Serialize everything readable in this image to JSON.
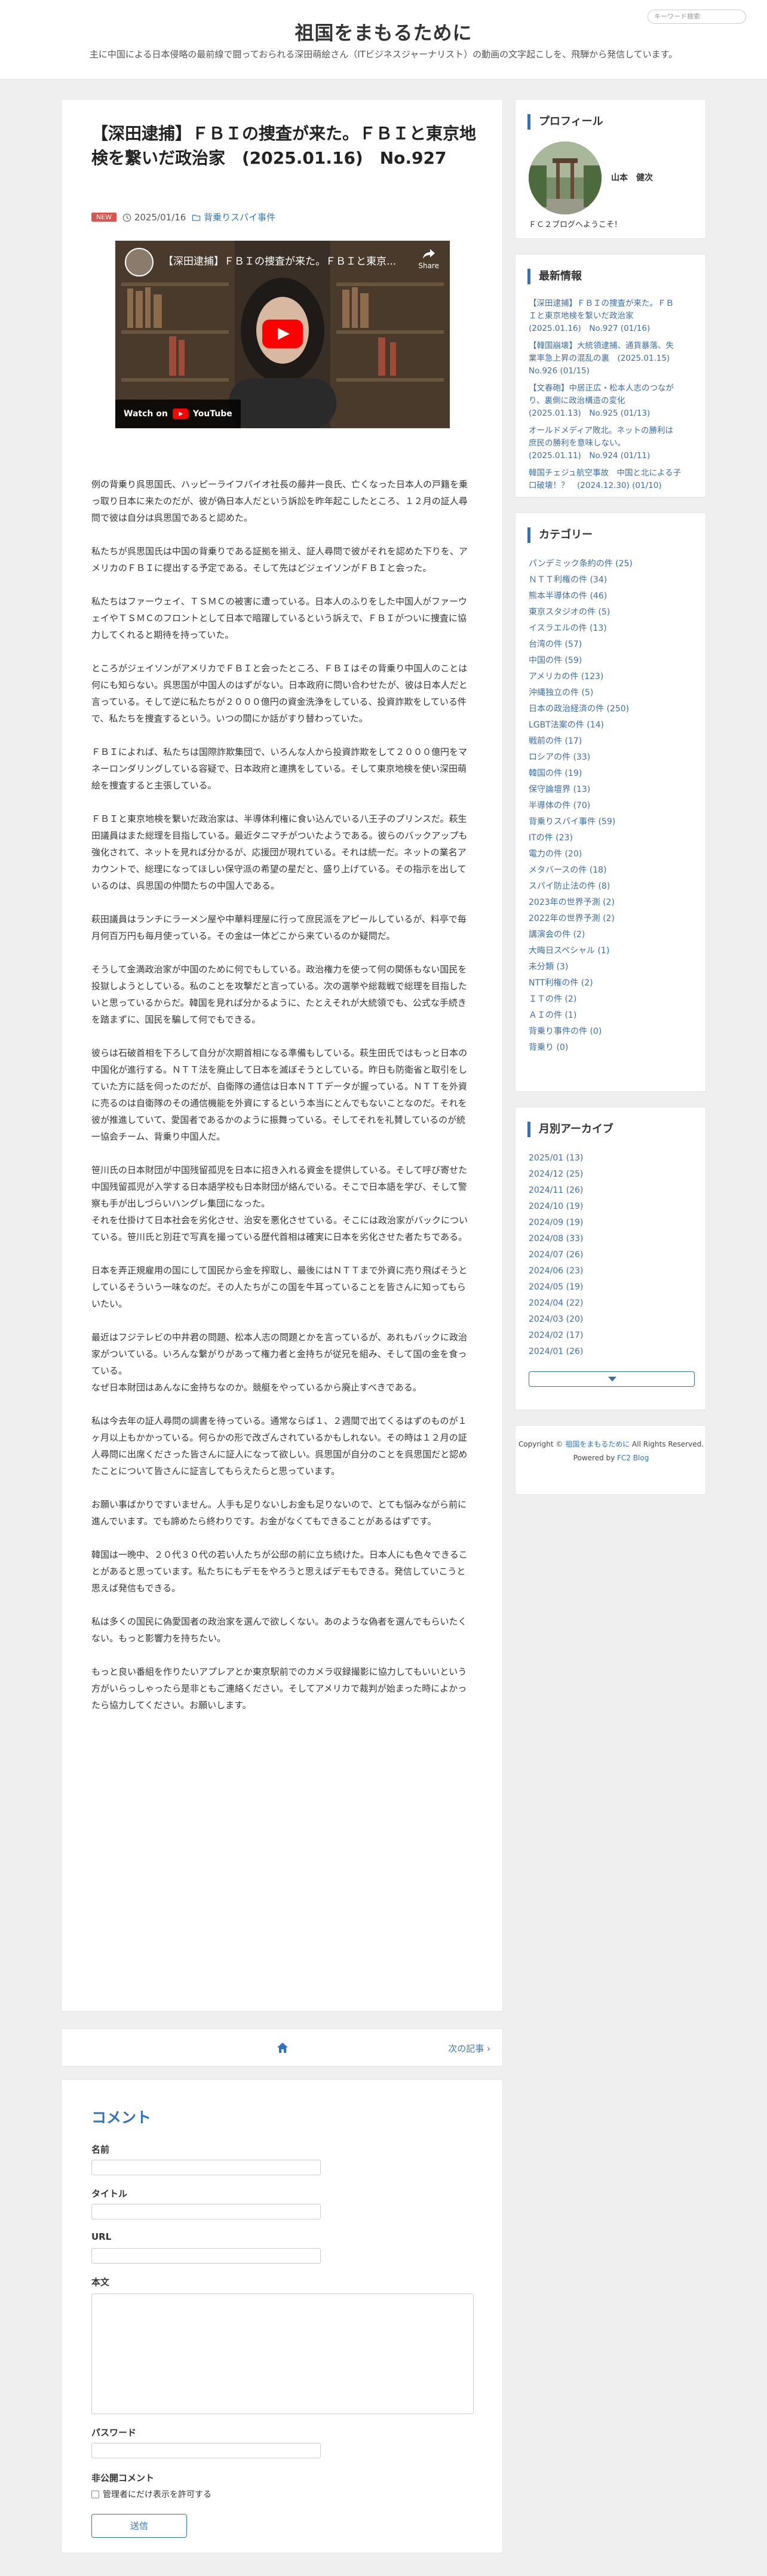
{
  "header": {
    "site_title": "祖国をまもるために",
    "site_desc": "主に中国による日本侵略の最前線で闘っておられる深田萌絵さん（ITビジネスジャーナリスト）の動画の文字起こしを、飛騨から発信しています。",
    "search_placeholder": "キーワード検索"
  },
  "article": {
    "title": "【深田逮捕】ＦＢＩの捜査が来た。ＦＢＩと東京地検を繋いだ政治家　(2025.01.16)　No.927",
    "badge": "NEW",
    "date": "2025/01/16",
    "category": "背乗りスパイ事件",
    "video": {
      "title": "【深田逮捕】ＦＢＩの捜査が来た。ＦＢＩと東京...",
      "share_label": "Share",
      "watch_label": "Watch on",
      "youtube_label": "YouTube"
    },
    "paragraphs": [
      "例の背乗り呉思国氏、ハッピーライフパイオ社長の藤井一良氏、亡くなった日本人の戸籍を乗っ取り日本に来たのだが、彼が偽日本人だという訴訟を昨年起こしたところ、１２月の証人尋問で彼は自分は呉思国であると認めた。",
      "私たちが呉思国氏は中国の背乗りである証拠を揃え、証人尋問で彼がそれを認めた下りを、アメリカのＦＢＩに提出する予定である。そして先はどジェイソンがＦＢＩと会った。",
      "私たちはファーウェイ、ＴＳＭＣの被害に遭っている。日本人のふりをした中国人がファーウェイやＴＳＭＣのフロントとして日本で暗躍しているという訴えで、ＦＢＩがついに捜査に協力してくれると期待を持っていた。",
      "ところがジェイソンがアメリカでＦＢＩと会ったところ、ＦＢＩはその背乗り中国人のことは何にも知らない。呉思国が中国人のはずがない。日本政府に問い合わせたが、彼は日本人だと言っている。そして逆に私たちが２０００億円の資金洗浄をしている、投資詐欺をしている件で、私たちを捜査するという。いつの間にか話がすり替わっていた。",
      "ＦＢＩによれば、私たちは国際詐欺集団で、いろんな人から投資詐欺をして２０００億円をマネーロンダリングしている容疑で、日本政府と連携をしている。そして東京地検を使い深田萌絵を捜査すると主張している。",
      "ＦＢＩと東京地検を繋いだ政治家は、半導体利権に食い込んでいる八王子のプリンスだ。萩生田議員はまた総理を目指している。最近タニマチがついたようである。彼らのバックアップも強化されて、ネットを見れば分かるが、応援団が現れている。それは統一だ。ネットの業名アカウントで、総理になってほしい保守派の希望の星だと、盛り上げている。その指示を出しているのは、呉思国の仲間たちの中国人である。",
      "萩田議員はランチにラーメン屋や中華料理屋に行って庶民派をアピールしているが、料亭で毎月何百万円も毎月使っている。その金は一体どこから来ているのか疑問だ。",
      "そうして金満政治家が中国のために何でもしている。政治権力を使って何の関係もない国民を投獄しようとしている。私のことを攻撃だと言っている。次の選挙や総裁戦で総理を目指したいと思っているからだ。韓国を見れば分かるように、たとえそれが大統領でも、公式な手続きを踏まずに、国民を騙して何でもできる。",
      "彼らは石破首相を下ろして自分が次期首相になる準備もしている。萩生田氏ではもっと日本の中国化が進行する。ＮＴＴ法を廃止して日本を滅ぼそうとしている。昨日も防衛省と取引をしていた方に話を伺ったのだが、自衛隊の通信は日本ＮＴＴデータが握っている。ＮＴＴを外資に売るのは自衛隊のその通信機能を外資にするという本当にとんでもないことなのだ。それを彼が推進していて、愛国者であるかのように振舞っている。そしてそれを礼賛しているのが統一協会チーム、背乗り中国人だ。",
      "笹川氏の日本財団が中国残留孤児を日本に招き入れる資金を提供している。そして呼び寄せた中国残留孤児が入学する日本語学校も日本財団が絡んでいる。そこで日本語を学び、そして警察も手が出しづらいハングレ集団になった。",
      "それを仕掛けて日本社会を劣化させ、治安を悪化させている。そこには政治家がバックについている。笹川氏と別荘で写真を撮っている歴代首相は確実に日本を劣化させた者たちである。",
      "日本を弄正規雇用の国にして国民から金を搾取し、最後にはＮＴＴまで外資に売り飛ばそうとしているそういう一味なのだ。その人たちがこの国を牛耳っていることを皆さんに知ってもらいたい。",
      "最近はフジテレビの中井君の問題、松本人志の問題とかを言っているが、あれもバックに政治家がついている。いろんな繋がりがあって権力者と金持ちが従兄を組み、そして国の金を食っている。",
      "なぜ日本財団はあんなに金持ちなのか。競艇をやっているから廃止すべきである。",
      "私は今去年の証人尋問の調書を待っている。通常ならば１、２週間で出てくるはずのものが１ヶ月以上もかかっている。何らかの形で改ざんされているかもしれない。その時は１２月の証人尋問に出席くださった皆さんに証人になって欲しい。呉思国が自分のことを呉思国だと認めたことについて皆さんに証言してもらえたらと思っています。",
      "お願い事ばかりですいません。人手も足りないしお金も足りないので、とても悩みながら前に進んでいます。でも諦めたら終わりです。お金がなくてもできることがあるはずです。",
      "韓国は一晩中、２０代３０代の若い人たちが公邸の前に立ち続けた。日本人にも色々できることがあると思っています。私たちにもデモをやろうと思えばデモもできる。発信していこうと思えば発信もできる。",
      "私は多くの国民に偽愛国者の政治家を選んで欲しくない。あのような偽者を選んでもらいたくない。もっと影響力を持ちたい。",
      "もっと良い番組を作りたいアプレアとか東京駅前でのカメラ収録撮影に協力してもいいという方がいらっしゃったら是非ともご連絡ください。そしてアメリカで裁判が始まった時によかったら協力してください。お願いします。"
    ]
  },
  "pager": {
    "next_label": "次の記事"
  },
  "comment": {
    "heading": "コメント",
    "name_label": "名前",
    "title_label": "タイトル",
    "url_label": "URL",
    "body_label": "本文",
    "password_label": "パスワード",
    "private_label": "非公開コメント",
    "private_check": "管理者にだけ表示を許可する",
    "submit_label": "送信"
  },
  "sidebar": {
    "profile": {
      "title": "プロフィール",
      "name": "山本　健次",
      "text": "ＦＣ２ブログへようこそ！"
    },
    "latest": {
      "title": "最新情報",
      "items": [
        [
          "【深田逮捕】ＦＢＩの捜査が来た。ＦＢ",
          "Ｉと東京地検を繋いだ政治家",
          "(2025.01.16)　No.927 (01/16)"
        ],
        [
          "【韓国崩壊】大統領逮捕、通貨暴落、失",
          "業率急上昇の混乱の裏　(2025.01.15)",
          "No.926 (01/15)"
        ],
        [
          "【文春砲】中居正広・松本人志のつなが",
          "り、裏側に政治構造の変化",
          "(2025.01.13)　No.925 (01/13)"
        ],
        [
          "オールドメディア敗北。ネットの勝利は",
          "庶民の勝利を意味しない。",
          "(2025.01.11)　No.924 (01/11)"
        ],
        [
          "韓国チェジュ航空事故　中国と北による子",
          "口破壊！？　(2024.12.30) (01/10)"
        ]
      ]
    },
    "categories": {
      "title": "カテゴリー",
      "items": [
        "パンデミック条約の件 (25)",
        "ＮＴＴ利権の件 (34)",
        "熊本半導体の件 (46)",
        "東京スタジオの件 (5)",
        "イスラエルの件 (13)",
        "台湾の件 (57)",
        "中国の件 (59)",
        "アメリカの件 (123)",
        "沖縄独立の件 (5)",
        "日本の政治経済の件 (250)",
        "LGBT法案の件 (14)",
        "戦前の件 (17)",
        "ロシアの件 (33)",
        "韓国の件 (19)",
        "保守論壇界 (13)",
        "半導体の件 (70)",
        "背乗りスパイ事件 (59)",
        "ITの件 (23)",
        "電力の件 (20)",
        "メタバースの件 (18)",
        "スパイ防止法の件 (8)",
        "2023年の世界予測 (2)",
        "2022年の世界予測 (2)",
        "講演会の件 (2)",
        "大晦日スペシャル (1)",
        "未分類 (3)",
        "NTT利権の件 (2)",
        "ＩＴの件 (2)",
        "ＡＩの件 (1)",
        "背乗り事件の件 (0)",
        "背乗り (0)"
      ]
    },
    "archive": {
      "title": "月別アーカイブ",
      "items": [
        "2025/01 (13)",
        "2024/12 (25)",
        "2024/11 (26)",
        "2024/10 (19)",
        "2024/09 (19)",
        "2024/08 (33)",
        "2024/07 (26)",
        "2024/06 (23)",
        "2024/05 (19)",
        "2024/04 (22)",
        "2024/03 (20)",
        "2024/02 (17)",
        "2024/01 (26)"
      ]
    },
    "footer": {
      "prefix": "Copyright ©",
      "site_link": "祖国をまもるために",
      "rights": "All Rights Reserved.",
      "powered_prefix": "Powered by",
      "powered_link": "FC2 Blog"
    }
  },
  "colors": {
    "accent": "#3273b8",
    "badge": "#d9534f",
    "link": "#3d6ea5"
  }
}
